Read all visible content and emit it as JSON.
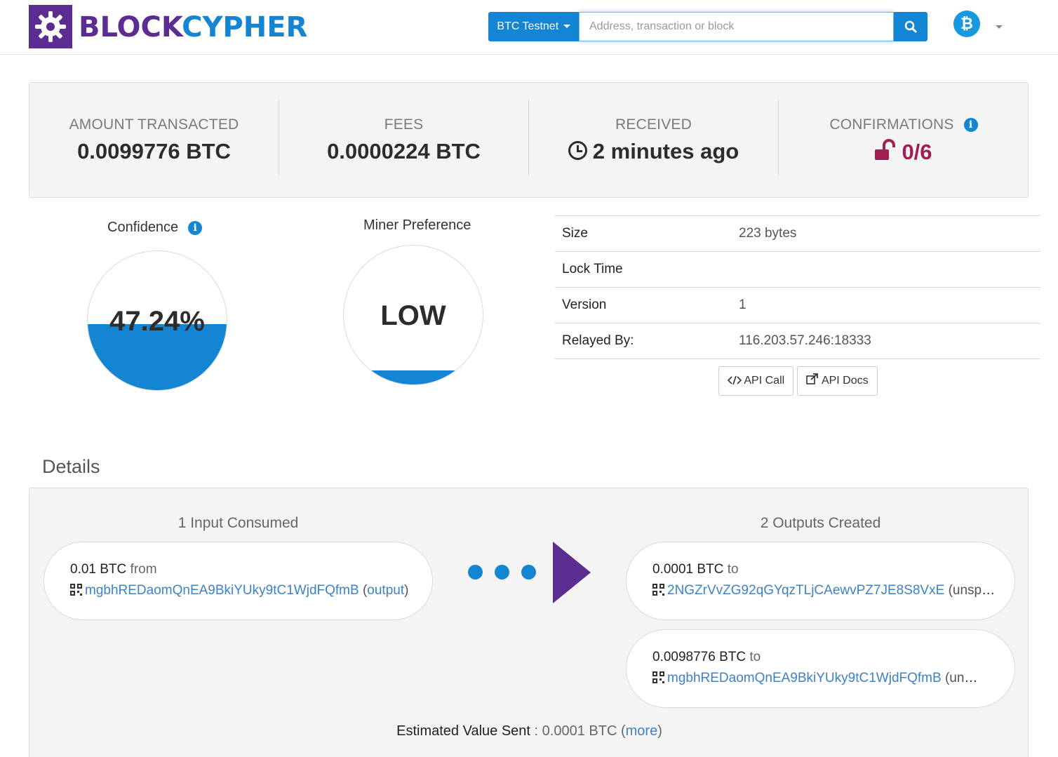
{
  "header": {
    "logo_part1": "BLOCK",
    "logo_part2": "CYPHER",
    "network_label": "BTC Testnet",
    "search_placeholder": "Address, transaction or block",
    "currency_glyph": "₿"
  },
  "stats": {
    "amount_label": "AMOUNT TRANSACTED",
    "amount_value": "0.0099776 BTC",
    "fees_label": "FEES",
    "fees_value": "0.0000224 BTC",
    "received_label": "RECEIVED",
    "received_value": "2 minutes ago",
    "confirmations_label": "CONFIRMATIONS",
    "confirmations_value": "0/6"
  },
  "gauges": {
    "confidence_title": "Confidence",
    "confidence_value": "47.24%",
    "confidence_fraction": 0.4724,
    "miner_title": "Miner Preference",
    "miner_value": "LOW",
    "miner_fraction": 0.1
  },
  "info_table": [
    {
      "key": "Size",
      "value": "223 bytes"
    },
    {
      "key": "Lock Time",
      "value": ""
    },
    {
      "key": "Version",
      "value": "1"
    },
    {
      "key": "Relayed By:",
      "value": "116.203.57.246:18333"
    }
  ],
  "buttons": {
    "api_call": "API Call",
    "api_docs": "API Docs"
  },
  "details": {
    "title": "Details",
    "inputs_title": "1 Input Consumed",
    "outputs_title": "2 Outputs Created",
    "inputs": [
      {
        "amount": "0.01 BTC",
        "word": "from",
        "address": "mgbhREDaomQnEA9BkiYUky9tC1WjdFQfmB",
        "status": "output"
      }
    ],
    "outputs": [
      {
        "amount": "0.0001 BTC",
        "word": "to",
        "address": "2NGZrVvZG92qGYqzTLjCAewvPZ7JE8S8VxE",
        "status": "(unspent)"
      },
      {
        "amount": "0.0098776 BTC",
        "word": "to",
        "address": "mgbhREDaomQnEA9BkiYUky9tC1WjdFQfmB",
        "status": "(unspent)"
      }
    ],
    "estimated_label": "Estimated Value Sent",
    "estimated_value": "0.0001 BTC",
    "more_link": "more"
  },
  "colors": {
    "brand_purple": "#5c2d91",
    "brand_blue": "#1385d2",
    "confirmation_red": "#a01e52"
  },
  "icons": [
    "logo-gear-icon",
    "search-icon",
    "bitcoin-icon",
    "info-icon",
    "clock-icon",
    "unlock-icon",
    "code-icon",
    "external-link-icon",
    "qr-code-icon",
    "arrow-right-icon"
  ]
}
